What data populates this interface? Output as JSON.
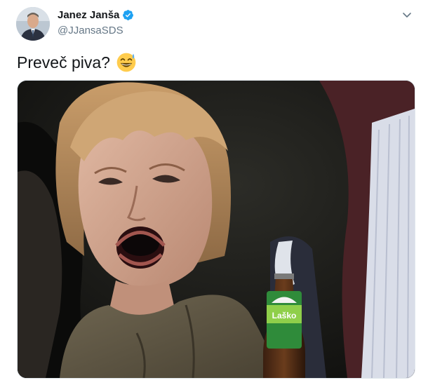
{
  "tweet": {
    "author": {
      "name": "Janez Janša",
      "handle": "@JJansaSDS",
      "verified": true
    },
    "text": "Preveč piva?",
    "emoji": "grinning-face-with-sweat",
    "media": {
      "bottle_label": "Laško"
    }
  },
  "icons": {
    "verified": "verified-badge-icon",
    "caret": "chevron-down-icon"
  },
  "colors": {
    "name": "#14171a",
    "handle": "#657786",
    "verified": "#1da1f2"
  }
}
